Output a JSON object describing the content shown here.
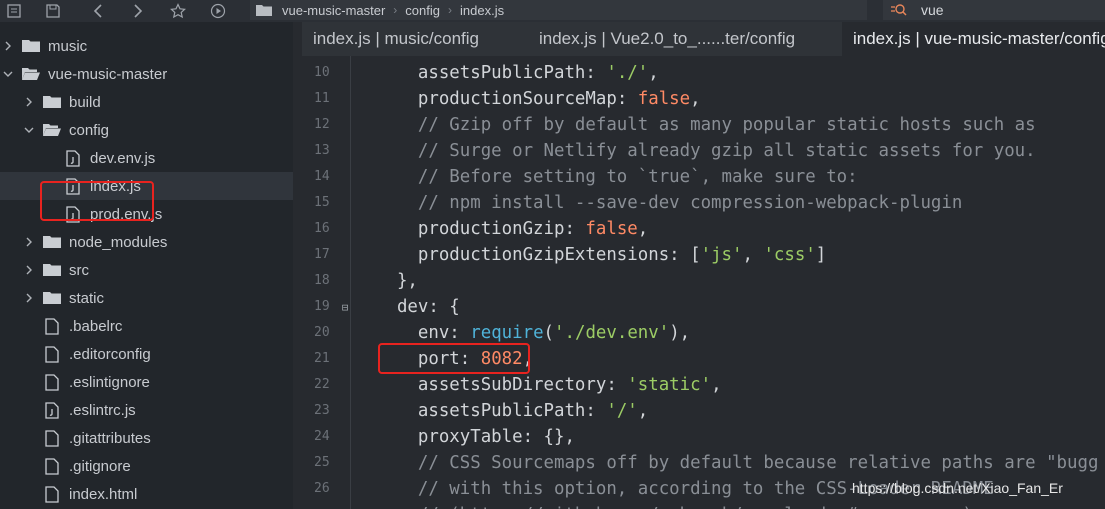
{
  "toolbar": {
    "icons": [
      "tree-icon",
      "save-icon",
      "back-icon",
      "forward-icon",
      "star-icon",
      "run-icon"
    ],
    "breadcrumb": [
      "vue-music-master",
      "config",
      "index.js"
    ],
    "search_value": "vue"
  },
  "sidebar": {
    "items": [
      {
        "label": "music",
        "type": "folder",
        "expanded": false
      },
      {
        "label": "vue-music-master",
        "type": "folder",
        "expanded": true
      },
      {
        "label": "build",
        "type": "folder",
        "expanded": false
      },
      {
        "label": "config",
        "type": "folder",
        "expanded": true
      },
      {
        "label": "dev.env.js",
        "type": "file"
      },
      {
        "label": "index.js",
        "type": "file",
        "selected": true
      },
      {
        "label": "prod.env.js",
        "type": "file"
      },
      {
        "label": "node_modules",
        "type": "folder",
        "expanded": false
      },
      {
        "label": "src",
        "type": "folder",
        "expanded": false
      },
      {
        "label": "static",
        "type": "folder",
        "expanded": false
      },
      {
        "label": ".babelrc",
        "type": "file"
      },
      {
        "label": ".editorconfig",
        "type": "file"
      },
      {
        "label": ".eslintignore",
        "type": "file"
      },
      {
        "label": ".eslintrc.js",
        "type": "file"
      },
      {
        "label": ".gitattributes",
        "type": "file"
      },
      {
        "label": ".gitignore",
        "type": "file"
      },
      {
        "label": "index.html",
        "type": "file"
      }
    ]
  },
  "tabs": [
    {
      "label": "index.js | music/config",
      "active": false
    },
    {
      "label": "index.js | Vue2.0_to_......ter/config",
      "active": false
    },
    {
      "label": "index.js | vue-music-master/config",
      "active": true
    }
  ],
  "code": {
    "line_numbers": [
      "10",
      "11",
      "12",
      "13",
      "14",
      "15",
      "16",
      "17",
      "18",
      "19",
      "20",
      "21",
      "22",
      "23",
      "24",
      "25",
      "26"
    ],
    "fold_marker": "⊟",
    "lines": [
      [
        [
          "    assetsPublicPath",
          "k"
        ],
        [
          ": ",
          "p"
        ],
        [
          "'./'",
          "s"
        ],
        [
          ",",
          "p"
        ]
      ],
      [
        [
          "    productionSourceMap",
          "k"
        ],
        [
          ": ",
          "p"
        ],
        [
          "false",
          "b"
        ],
        [
          ",",
          "p"
        ]
      ],
      [
        [
          "    // Gzip off by default as many popular static hosts such as",
          "c"
        ]
      ],
      [
        [
          "    // Surge or Netlify already gzip all static assets for you.",
          "c"
        ]
      ],
      [
        [
          "    // Before setting to `true`, make sure to:",
          "c"
        ]
      ],
      [
        [
          "    // npm install --save-dev compression-webpack-plugin",
          "c"
        ]
      ],
      [
        [
          "    productionGzip",
          "k"
        ],
        [
          ": ",
          "p"
        ],
        [
          "false",
          "b"
        ],
        [
          ",",
          "p"
        ]
      ],
      [
        [
          "    productionGzipExtensions",
          "k"
        ],
        [
          ": [",
          "p"
        ],
        [
          "'js'",
          "s"
        ],
        [
          ", ",
          "p"
        ],
        [
          "'css'",
          "s"
        ],
        [
          "]",
          "p"
        ]
      ],
      [
        [
          "  },",
          "p"
        ]
      ],
      [
        [
          "  dev",
          "k"
        ],
        [
          ": {",
          "p"
        ]
      ],
      [
        [
          "    env",
          "k"
        ],
        [
          ": ",
          "p"
        ],
        [
          "require",
          "f"
        ],
        [
          "(",
          "p"
        ],
        [
          "'./dev.env'",
          "s"
        ],
        [
          "),",
          "p"
        ]
      ],
      [
        [
          "    port",
          "k"
        ],
        [
          ": ",
          "p"
        ],
        [
          "8082",
          "n"
        ],
        [
          ",",
          "p"
        ]
      ],
      [
        [
          "    assetsSubDirectory",
          "k"
        ],
        [
          ": ",
          "p"
        ],
        [
          "'static'",
          "s"
        ],
        [
          ",",
          "p"
        ]
      ],
      [
        [
          "    assetsPublicPath",
          "k"
        ],
        [
          ": ",
          "p"
        ],
        [
          "'/'",
          "s"
        ],
        [
          ",",
          "p"
        ]
      ],
      [
        [
          "    proxyTable",
          "k"
        ],
        [
          ": {},",
          "p"
        ]
      ],
      [
        [
          "    // CSS Sourcemaps off by default because relative paths are \"bugg",
          "c"
        ]
      ],
      [
        [
          "    // with this option, according to the CSS-Loader README",
          "c"
        ]
      ],
      [
        [
          "    // (https://github.com/webpack/css-loader#sourcemaps)",
          "c"
        ]
      ]
    ]
  },
  "watermark": "https://blog.csdn.net/Xiao_Fan_Er"
}
